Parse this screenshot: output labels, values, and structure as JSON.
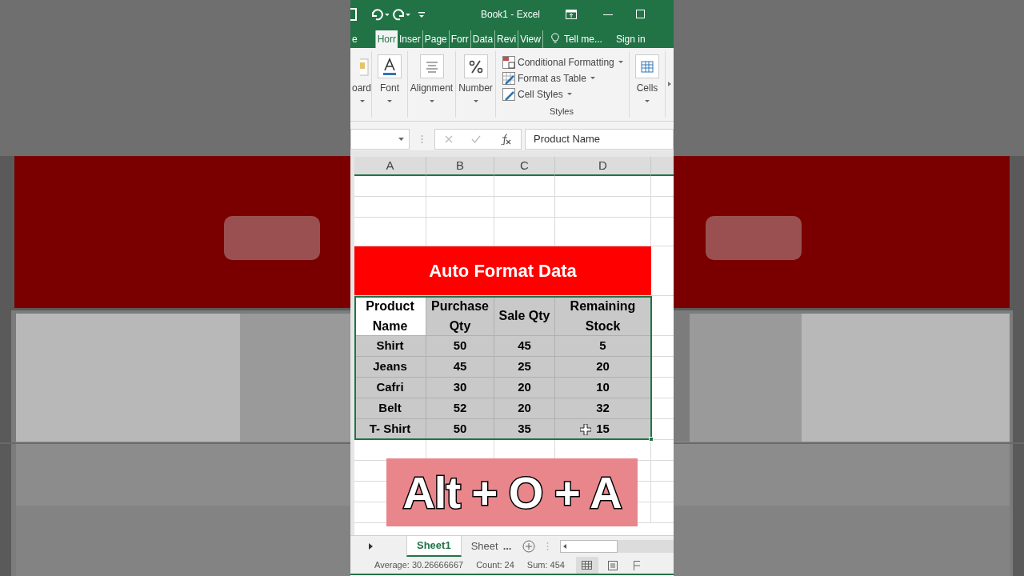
{
  "background": {
    "kind": "picture"
  },
  "title_bar": {
    "title": "Book1 - Excel"
  },
  "ribbon_tabs": [
    {
      "label": "e",
      "selected": false
    },
    {
      "label": "Horr",
      "selected": true
    },
    {
      "label": "Inser",
      "selected": false
    },
    {
      "label": "Page",
      "selected": false
    },
    {
      "label": "Forr",
      "selected": false
    },
    {
      "label": "Data",
      "selected": false
    },
    {
      "label": "Revi",
      "selected": false
    },
    {
      "label": "View",
      "selected": false
    }
  ],
  "tell_me": "Tell me...",
  "sign_in": "Sign in",
  "ribbon_groups": [
    {
      "label": "oard"
    },
    {
      "label": "Font"
    },
    {
      "label": "Alignment"
    },
    {
      "label": "Number"
    }
  ],
  "styles_group": {
    "items": [
      "Conditional Formatting",
      "Format as Table",
      "Cell Styles"
    ],
    "label": "Styles"
  },
  "cells_group": {
    "label": "Cells"
  },
  "formula_bar": {
    "value": "Product Name"
  },
  "columns": [
    "A",
    "B",
    "C",
    "D"
  ],
  "table": {
    "title": "Auto Format Data",
    "header": [
      "Product Name",
      "Purchase Qty",
      "Sale Qty",
      "Remaining Stock"
    ],
    "rows": [
      [
        "Shirt",
        "50",
        "45",
        "5"
      ],
      [
        "Jeans",
        "45",
        "25",
        "20"
      ],
      [
        "Cafri",
        "30",
        "20",
        "10"
      ],
      [
        "Belt",
        "52",
        "20",
        "32"
      ],
      [
        "T- Shirt",
        "50",
        "35",
        "15"
      ]
    ]
  },
  "overlay": "Alt + O + A",
  "sheet_tabs": [
    {
      "label": "Sheet1",
      "selected": true
    },
    {
      "label": "Sheet",
      "selected": false
    }
  ],
  "sheet_more": "...",
  "status_bar": {
    "average": "Average: 30.26666667",
    "count": "Count: 24",
    "sum": "Sum: 454"
  }
}
